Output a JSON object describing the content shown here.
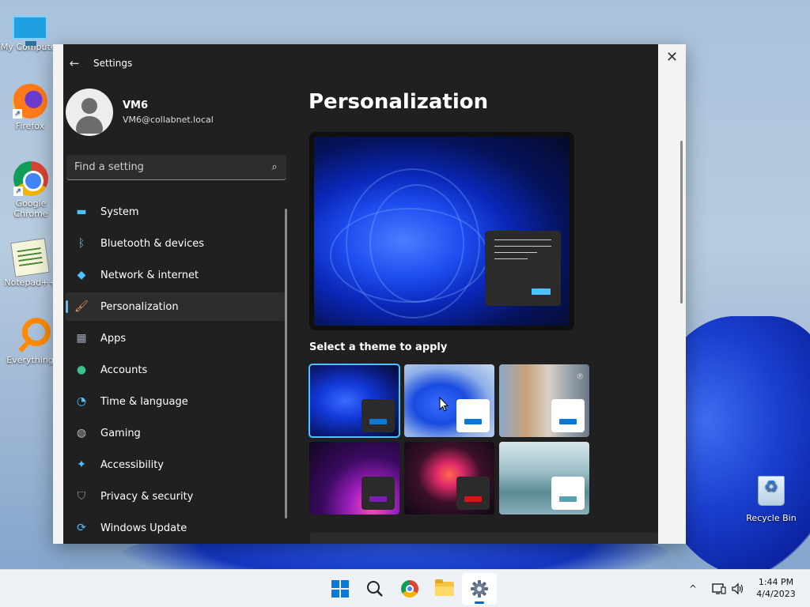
{
  "desktop": {
    "icons": [
      {
        "label": "My Computer",
        "icon": "monitor-icon"
      },
      {
        "label": "Firefox",
        "icon": "firefox-icon"
      },
      {
        "label": "Google Chrome",
        "icon": "chrome-icon"
      },
      {
        "label": "Notepad++",
        "icon": "notepad-plus-plus-icon"
      },
      {
        "label": "Everything",
        "icon": "everything-search-icon"
      },
      {
        "label": "Recycle Bin",
        "icon": "recycle-bin-icon"
      }
    ]
  },
  "window": {
    "title": "Settings",
    "back_glyph": "←",
    "close_glyph": "✕"
  },
  "profile": {
    "name": "VM6",
    "email": "VM6@collabnet.local"
  },
  "search": {
    "placeholder": "Find a setting",
    "value": ""
  },
  "nav": {
    "items": [
      {
        "label": "System",
        "icon": "system-monitor-icon",
        "glyph": "▬",
        "color": "#4cc2ff"
      },
      {
        "label": "Bluetooth & devices",
        "icon": "bluetooth-icon",
        "glyph": "ᛒ",
        "color": "#4cc2ff"
      },
      {
        "label": "Network & internet",
        "icon": "wifi-icon",
        "glyph": "◆",
        "color": "#4cc2ff"
      },
      {
        "label": "Personalization",
        "icon": "paintbrush-icon",
        "glyph": "🖌",
        "color": "#f0a060"
      },
      {
        "label": "Apps",
        "icon": "apps-icon",
        "glyph": "▦",
        "color": "#9aa8b8"
      },
      {
        "label": "Accounts",
        "icon": "accounts-icon",
        "glyph": "●",
        "color": "#3bc48a"
      },
      {
        "label": "Time & language",
        "icon": "clock-globe-icon",
        "glyph": "◔",
        "color": "#4cc2ff"
      },
      {
        "label": "Gaming",
        "icon": "gamepad-icon",
        "glyph": "◍",
        "color": "#bbbbbb"
      },
      {
        "label": "Accessibility",
        "icon": "accessibility-icon",
        "glyph": "✦",
        "color": "#4cc2ff"
      },
      {
        "label": "Privacy & security",
        "icon": "shield-icon",
        "glyph": "⛉",
        "color": "#9a9a9a"
      },
      {
        "label": "Windows Update",
        "icon": "windows-update-icon",
        "glyph": "⟳",
        "color": "#4cc2ff"
      }
    ],
    "active_index": 3
  },
  "main": {
    "title": "Personalization",
    "theme_heading": "Select a theme to apply",
    "themes": [
      {
        "name": "windows-dark",
        "selected": true,
        "bg": "radial-gradient(ellipse at 40% 50%,#3a6cff 0%,#1238d8 35%,#0a1a78 70%,#050b2a 100%)",
        "swatch": "#2b2b2b",
        "bar": "#0a78d7"
      },
      {
        "name": "windows-light",
        "selected": false,
        "bg": "radial-gradient(ellipse at 40% 55%,#3a6cff 0%,#1a4be0 35%,#8fb0e8 65%,#c8d8f0 100%)",
        "swatch": "#ffffff",
        "bar": "#0a78d7"
      },
      {
        "name": "captured-motion",
        "selected": false,
        "bg": "linear-gradient(90deg,#8aa8c8 0%,#c9a27a 30%,#d9d0c8 55%,#a0a8b0 75%,#6a7888 100%)",
        "swatch": "#ffffff",
        "bar": "#0a78d7",
        "camera": true
      },
      {
        "name": "glow",
        "selected": false,
        "bg": "radial-gradient(ellipse at 70% 90%,#ff4fb0 0%,#a020c0 25%,#3a0a60 55%,#120620 100%)",
        "swatch": "#2b2b2b",
        "bar": "#7a1fb0"
      },
      {
        "name": "sunrise",
        "selected": false,
        "bg": "radial-gradient(ellipse at 50% 45%,#ff6a4a 0%,#e02a6a 20%,#3a1028 50%,#0e0a12 100%)",
        "swatch": "#2b2b2b",
        "bar": "#d01818"
      },
      {
        "name": "flow",
        "selected": false,
        "bg": "linear-gradient(180deg,#d8e6ea 0%,#9ec0c8 40%,#5a8a94 70%,#8ab0b8 100%)",
        "swatch": "#ffffff",
        "bar": "#5aa0b0"
      }
    ]
  },
  "taskbar": {
    "apps": [
      {
        "name": "start",
        "icon": "windows-start-icon"
      },
      {
        "name": "search",
        "icon": "search-icon"
      },
      {
        "name": "chrome",
        "icon": "chrome-icon"
      },
      {
        "name": "file-explorer",
        "icon": "folder-icon"
      },
      {
        "name": "settings",
        "icon": "gear-icon",
        "active": true
      }
    ],
    "tray": {
      "chevron": "^",
      "time": "1:44 PM",
      "date": "4/4/2023"
    }
  }
}
